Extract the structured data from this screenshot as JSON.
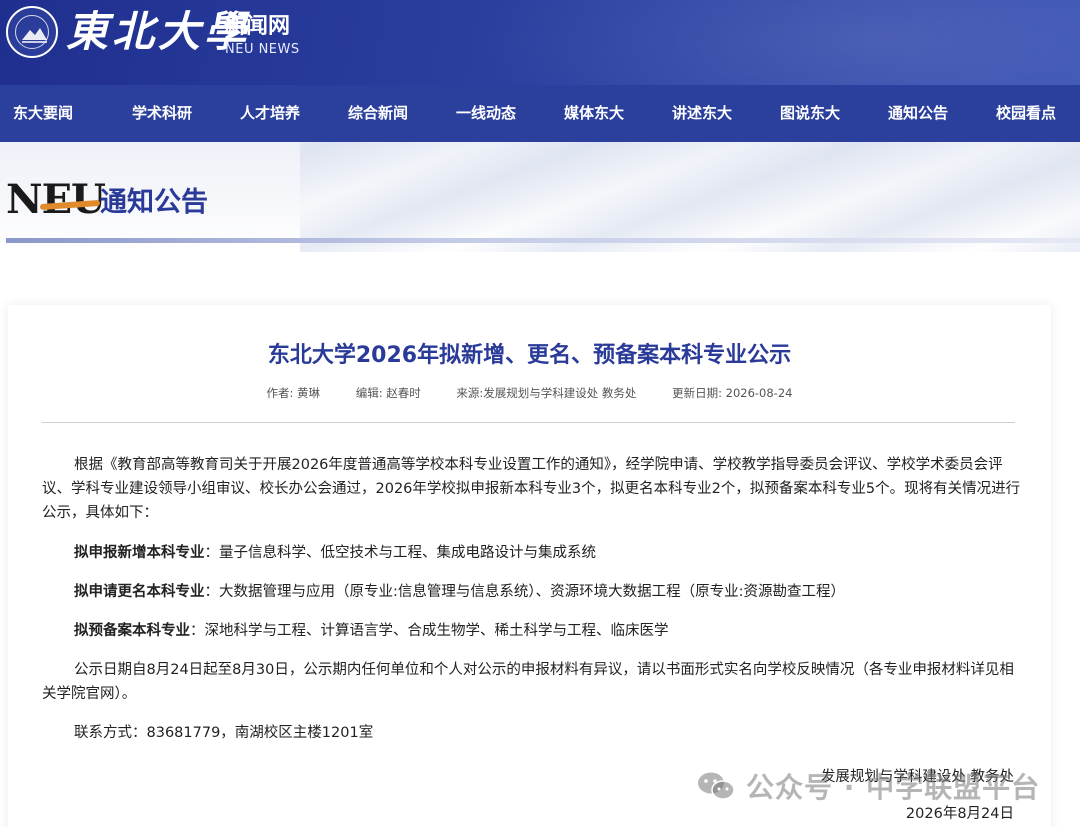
{
  "header": {
    "logo_cn": "東北大學",
    "site_name": "新闻网",
    "site_sub": "NEU NEWS"
  },
  "nav": {
    "items": [
      "东大要闻",
      "学术科研",
      "人才培养",
      "综合新闻",
      "一线动态",
      "媒体东大",
      "讲述东大",
      "图说东大",
      "通知公告",
      "校园看点"
    ]
  },
  "banner": {
    "mark": "NEU",
    "title": "通知公告"
  },
  "article": {
    "title": "东北大学2026年拟新增、更名、预备案本科专业公示",
    "meta": {
      "author": "作者: 黄琳",
      "editor": "编辑: 赵春时",
      "source": "来源:发展规划与学科建设处 教务处",
      "date": "更新日期: 2026-08-24"
    },
    "p1": "根据《教育部高等教育司关于开展2026年度普通高等学校本科专业设置工作的通知》，经学院申请、学校教学指导委员会评议、学校学术委员会评议、学科专业建设领导小组审议、校长办公会通过，2026年学校拟申报新本科专业3个，拟更名本科专业2个，拟预备案本科专业5个。现将有关情况进行公示，具体如下：",
    "new_label": "拟申报新增本科专业",
    "new_text": "：量子信息科学、低空技术与工程、集成电路设计与集成系统",
    "rename_label": "拟申请更名本科专业",
    "rename_text": "：大数据管理与应用（原专业:信息管理与信息系统）、资源环境大数据工程（原专业:资源勘查工程）",
    "prerecord_label": "拟预备案本科专业",
    "prerecord_text": "：深地科学与工程、计算语言学、合成生物学、稀土科学与工程、临床医学",
    "p5": "公示日期自8月24日起至8月30日，公示期内任何单位和个人对公示的申报材料有异议，请以书面形式实名向学校反映情况（各专业申报材料详见相关学院官网）。",
    "contact": "联系方式：83681779，南湖校区主楼1201室",
    "sign_org": "发展规划与学科建设处 教务处",
    "sign_date": "2026年8月24日"
  },
  "watermark": {
    "text": "公众号 · 中学联盟平台",
    "icon": "wechat-icon"
  }
}
